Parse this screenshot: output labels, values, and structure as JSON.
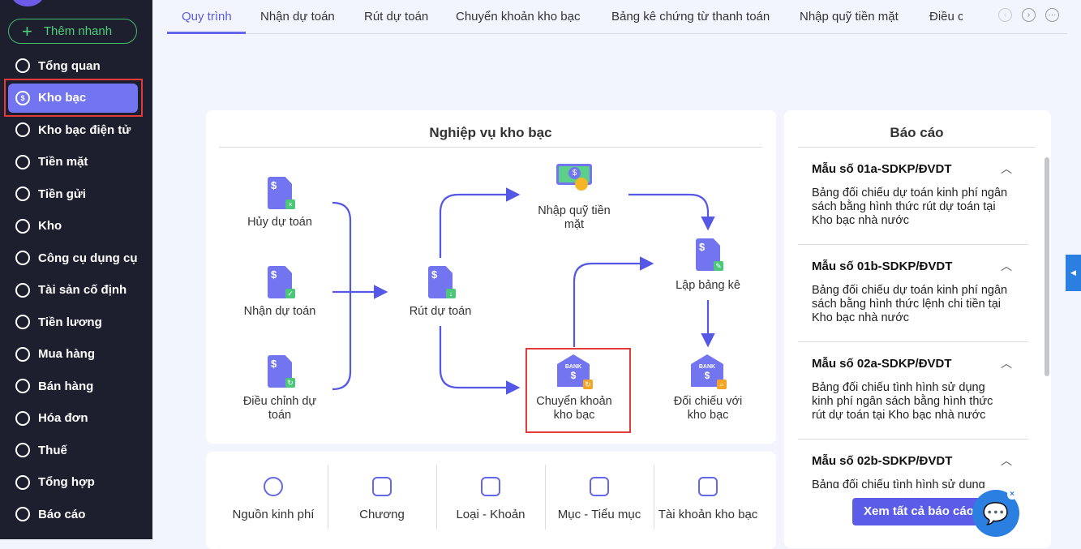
{
  "sidebar": {
    "quick_add": "Thêm nhanh",
    "items": [
      {
        "label": "Tổng quan",
        "icon": "pie-chart-icon"
      },
      {
        "label": "Kho bạc",
        "icon": "treasury-icon",
        "active": true
      },
      {
        "label": "Kho bạc điện tử",
        "icon": "e-treasury-icon"
      },
      {
        "label": "Tiền mặt",
        "icon": "cash-icon"
      },
      {
        "label": "Tiền gửi",
        "icon": "deposit-icon"
      },
      {
        "label": "Kho",
        "icon": "warehouse-icon"
      },
      {
        "label": "Công cụ dụng cụ",
        "icon": "tools-icon"
      },
      {
        "label": "Tài sản cố định",
        "icon": "truck-icon"
      },
      {
        "label": "Tiền lương",
        "icon": "salary-icon"
      },
      {
        "label": "Mua hàng",
        "icon": "cart-icon"
      },
      {
        "label": "Bán hàng",
        "icon": "sales-icon"
      },
      {
        "label": "Hóa đơn",
        "icon": "invoice-icon"
      },
      {
        "label": "Thuế",
        "icon": "tax-icon"
      },
      {
        "label": "Tổng hợp",
        "icon": "summary-icon"
      },
      {
        "label": "Báo cáo",
        "icon": "report-icon"
      }
    ]
  },
  "tabs": [
    "Quy trình",
    "Nhận dự toán",
    "Rút dự toán",
    "Chuyển khoản kho bạc",
    "Bảng kê chứng từ thanh toán",
    "Nhập quỹ tiền mặt",
    "Điều c"
  ],
  "diagram": {
    "title": "Nghiệp vụ kho bạc",
    "nodes": {
      "huy": "Hủy dự toán",
      "nhan": "Nhận dự toán",
      "dieu1": "Điều chỉnh dự",
      "dieu2": "toán",
      "rut": "Rút dự toán",
      "nhap1": "Nhập quỹ tiền",
      "nhap2": "mặt",
      "lap": "Lập bảng kê",
      "chuyen1": "Chuyển khoản",
      "chuyen2": "kho bạc",
      "doi1": "Đối chiếu với",
      "doi2": "kho bạc"
    },
    "bank_text": "BANK"
  },
  "categories": [
    "Nguồn kinh phí",
    "Chương",
    "Loại - Khoản",
    "Mục - Tiểu mục",
    "Tài khoản kho bạc"
  ],
  "reports": {
    "title": "Báo cáo",
    "items": [
      {
        "code": "Mẫu số 01a-SDKP/ĐVDT",
        "desc": [
          "Bảng đối chiếu dự toán kinh phí ngân",
          "sách bằng hình thức rút dự toán tại",
          "Kho bạc nhà nước"
        ]
      },
      {
        "code": "Mẫu số 01b-SDKP/ĐVDT",
        "desc": [
          "Bảng đối chiếu dự toán kinh phí ngân",
          "sách bằng hình thức lệnh chi tiền tại",
          "Kho bạc nhà nước"
        ]
      },
      {
        "code": "Mẫu số 02a-SDKP/ĐVDT",
        "desc": [
          "Bảng đối chiếu tình hình sử dụng",
          "kinh phí ngân sách bằng hình thức",
          "rút dự toán tại Kho bạc nhà nước"
        ]
      },
      {
        "code": "Mẫu số 02b-SDKP/ĐVDT",
        "desc": [
          "Bảng đối chiếu tình hình sử dụng"
        ]
      }
    ],
    "view_all": "Xem tất cả báo cáo"
  },
  "colors": {
    "accent": "#6367e8",
    "sidebar": "#1e1f2e",
    "active": "#7375f0",
    "highlight": "#e53a3a"
  }
}
